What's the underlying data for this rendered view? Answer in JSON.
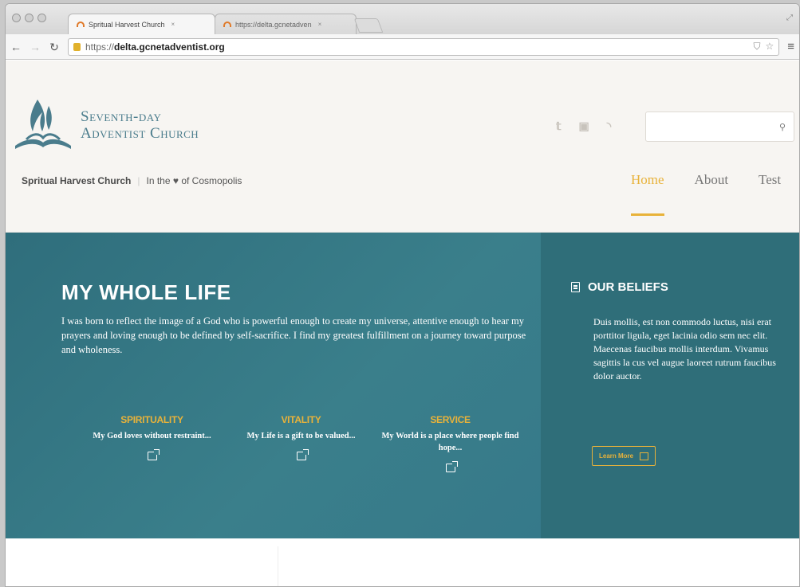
{
  "browser": {
    "tabs": [
      {
        "label": "Spritual Harvest Church",
        "close": "×"
      },
      {
        "label": "https://delta.gcnetadven",
        "close": "×"
      }
    ],
    "url_prefix": "https://",
    "url_domain": "delta.gcnetadventist.org",
    "icons": [
      "back-icon",
      "forward-icon",
      "reload-icon",
      "lock-icon",
      "shield-icon",
      "star-icon",
      "menu-icon"
    ]
  },
  "site": {
    "logo_line1": "Seventh-day",
    "logo_line2": "Adventist Church",
    "church_name": "Spritual Harvest Church",
    "tagline_before": "In the",
    "tagline_after": "of Cosmopolis",
    "social_icons": [
      "twitter-icon",
      "facebook-icon",
      "rss-icon"
    ],
    "search": {
      "placeholder": "",
      "value": ""
    }
  },
  "nav": {
    "items": [
      {
        "label": "Home",
        "active": true
      },
      {
        "label": "About",
        "active": false
      },
      {
        "label": "Test",
        "active": false
      }
    ]
  },
  "hero": {
    "title": "MY WHOLE LIFE",
    "text": "I was born to reflect the image of a God who is powerful enough to create my universe, attentive enough to hear my prayers and loving enough to be defined by self-sacrifice. I find my greatest fulfillment on a journey toward purpose and wholeness.",
    "pillars": [
      {
        "title": "SPIRITUALITY",
        "text": "My God loves without restraint...",
        "icon": "share-icon"
      },
      {
        "title": "VITALITY",
        "text": "My Life is a gift to be valued...",
        "icon": "share-icon"
      },
      {
        "title": "SERVICE",
        "text": "My World is a place where people find hope...",
        "icon": "share-icon"
      }
    ]
  },
  "beliefs": {
    "title": "OUR BELIEFS",
    "text": "Duis mollis, est non commodo luctus, nisi erat porttitor ligula, eget lacinia odio sem nec elit. Maecenas faucibus mollis interdum. Vivamus sagittis la cus vel augue laoreet rutrum faucibus dolor auctor.",
    "button": "Learn More"
  },
  "colors": {
    "accent": "#e8b23a",
    "teal": "#3a7f8b",
    "teal_dark": "#2f6e79",
    "logo": "#4a7c8c"
  }
}
